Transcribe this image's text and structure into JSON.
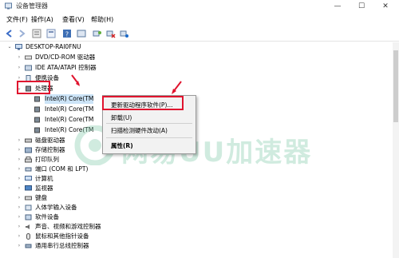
{
  "window": {
    "title": "设备管理器",
    "controls": [
      "—",
      "☐",
      "✕"
    ]
  },
  "menu": [
    "文件(F)",
    "操作(A)",
    "查看(V)",
    "帮助(H)"
  ],
  "tree": {
    "root": "DESKTOP-RAI0FNU",
    "categories": [
      "DVD/CD-ROM 驱动器",
      "IDE ATA/ATAPI 控制器",
      "便携设备",
      "处理器"
    ],
    "processors": [
      "Intel(R) Core(TM",
      "Intel(R) Core(TM",
      "Intel(R) Core(TM",
      "Intel(R) Core(TM"
    ],
    "more": [
      "磁盘驱动器",
      "存储控制器",
      "打印队列",
      "端口 (COM 和 LPT)",
      "计算机",
      "监视器",
      "键盘",
      "人体学输入设备",
      "软件设备",
      "声音、视频和游戏控制器",
      "鼠标和其他指针设备",
      "通用串行总线控制器"
    ]
  },
  "context_menu": {
    "update": "更新驱动程序软件(P)...",
    "uninstall": "卸载(U)",
    "scan": "扫描检测硬件改动(A)",
    "properties": "属性(R)"
  },
  "watermark": "网易UU加速器",
  "colors": {
    "highlight": "#e0142e",
    "watermark": "#7bc7a6"
  }
}
